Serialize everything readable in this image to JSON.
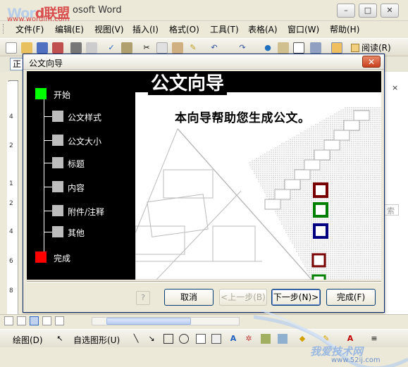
{
  "watermark": {
    "logo_a": "Wor",
    "logo_b": "d",
    "logo_c": "联盟",
    "url": "www.wordlm.com"
  },
  "window": {
    "title": "osoft Word",
    "minimize": "–",
    "maximize": "□",
    "close": "✕"
  },
  "menu": [
    {
      "label": "文件(F)"
    },
    {
      "label": "编辑(E)"
    },
    {
      "label": "视图(V)"
    },
    {
      "label": "插入(I)"
    },
    {
      "label": "格式(O)"
    },
    {
      "label": "工具(T)"
    },
    {
      "label": "表格(A)"
    },
    {
      "label": "窗口(W)"
    },
    {
      "label": "帮助(H)"
    }
  ],
  "toolbar": {
    "read_label": "阅读(R)"
  },
  "style_box": {
    "value": "正"
  },
  "ruler": {
    "tab_selector": "L",
    "ticks": [
      "4",
      "2",
      "1",
      "2",
      "4",
      "6",
      "8"
    ]
  },
  "side_panel": {
    "close": "×",
    "field": "索"
  },
  "dialog": {
    "title": "公文向导",
    "close": "✕",
    "banner": "公文向导",
    "headline": "本向导帮助您生成公文。",
    "steps": [
      {
        "label": "开始",
        "state": "current",
        "color": "#00ff00"
      },
      {
        "label": "公文样式",
        "state": "pending",
        "color": "#bdbdbd"
      },
      {
        "label": "公文大小",
        "state": "pending",
        "color": "#bdbdbd"
      },
      {
        "label": "标题",
        "state": "pending",
        "color": "#bdbdbd"
      },
      {
        "label": "内容",
        "state": "pending",
        "color": "#bdbdbd"
      },
      {
        "label": "附件/注释",
        "state": "pending",
        "color": "#bdbdbd"
      },
      {
        "label": "其他",
        "state": "pending",
        "color": "#bdbdbd"
      },
      {
        "label": "完成",
        "state": "end",
        "color": "#ff0000"
      }
    ],
    "buttons": {
      "cancel": "取消",
      "back": "<上一步(B)",
      "next": "下一步(N)>",
      "finish": "完成(F)"
    },
    "squares": [
      "#7a0000",
      "#008000",
      "#000080"
    ]
  },
  "drawbar": {
    "draw": "绘图(D)",
    "autoshapes": "自选图形(U)"
  },
  "watermark2": {
    "text": "我爱技术网",
    "url": "www.52ij.com"
  }
}
